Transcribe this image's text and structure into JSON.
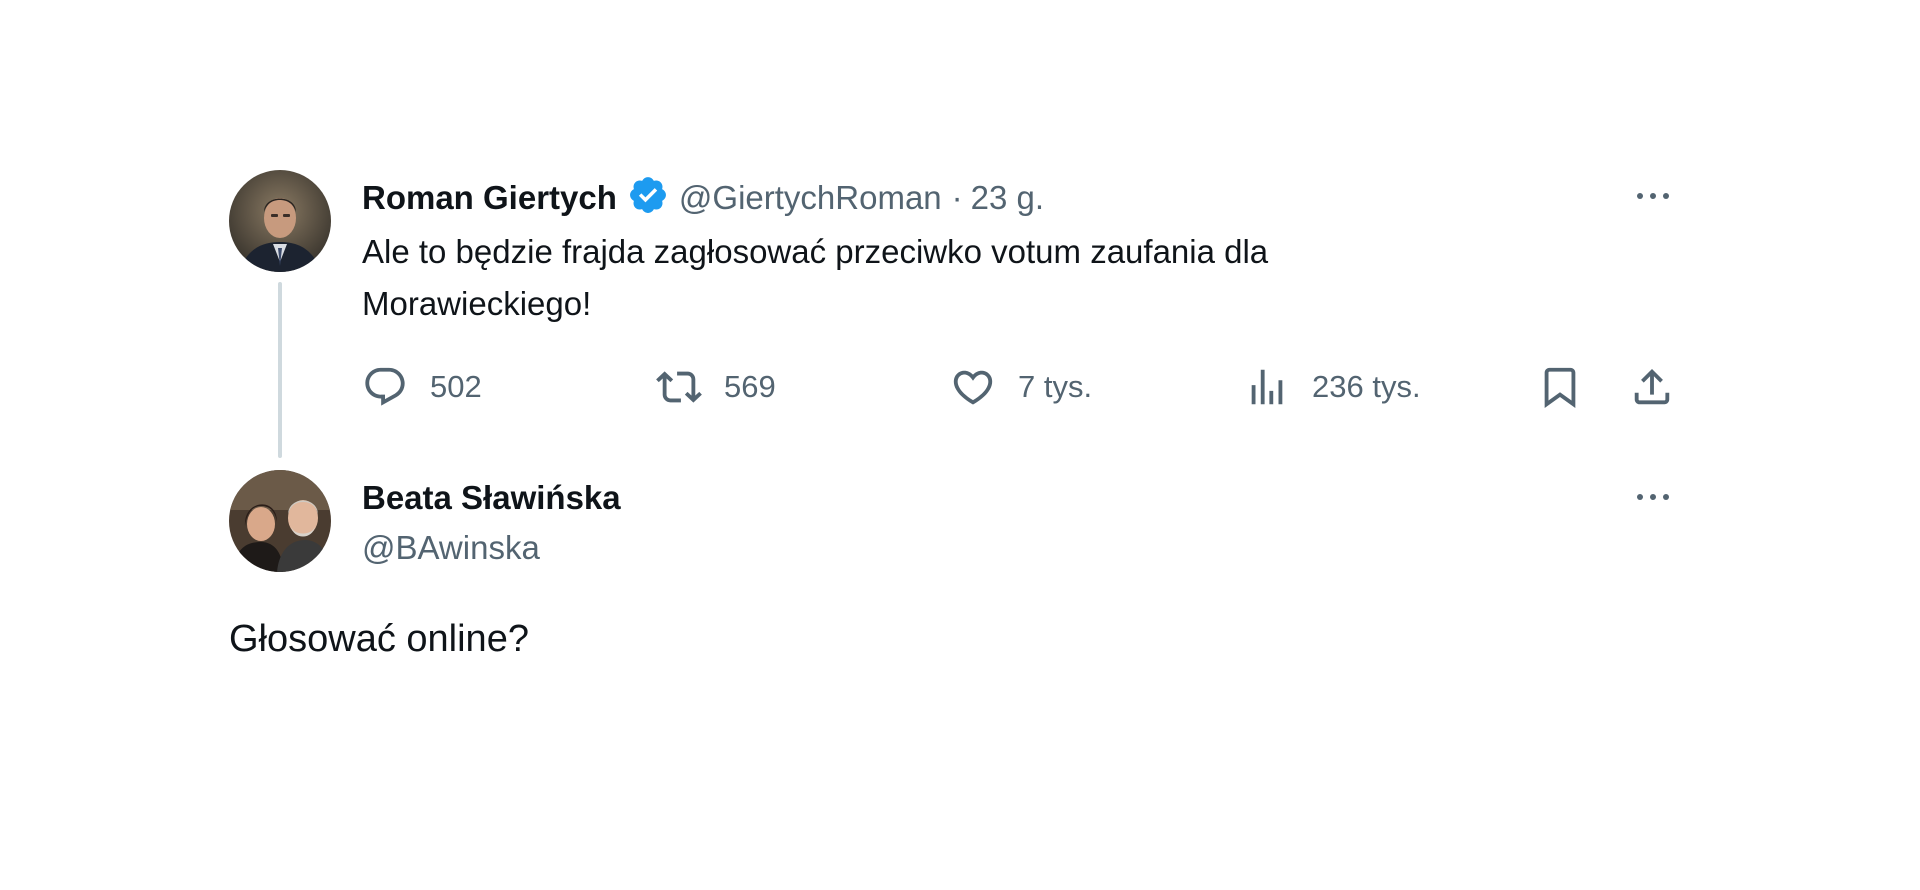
{
  "tweet": {
    "author_name": "Roman Giertych",
    "author_handle": "@GiertychRoman",
    "separator": "·",
    "time": "23 g.",
    "text": "Ale to będzie frajda zagłosować przeciwko votum zaufania dla\nMorawieckiego!",
    "verified": true,
    "stats": {
      "replies": "502",
      "retweets": "569",
      "likes": "7 tys.",
      "views": "236 tys."
    }
  },
  "reply": {
    "author_name": "Beata Sławińska",
    "author_handle": "@BAwinska",
    "text": "Głosować online?"
  },
  "colors": {
    "text_primary": "#0f1419",
    "text_secondary": "#536471",
    "verified_blue": "#1d9bf0",
    "thread_line": "#cfd9de"
  }
}
